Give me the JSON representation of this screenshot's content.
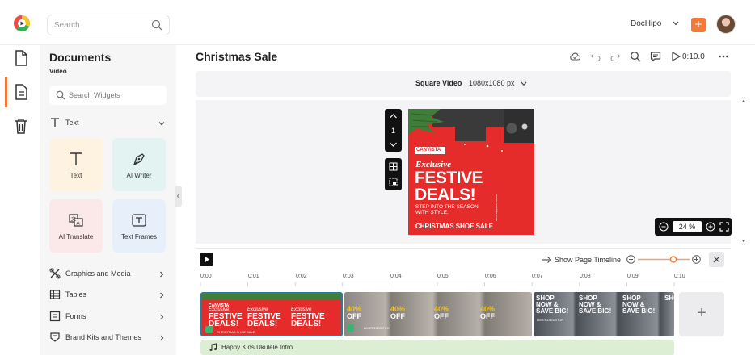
{
  "topbar": {
    "search_placeholder": "Search",
    "brand_label": "DocHipo",
    "add_label": "+",
    "colors": {
      "accent": "#f47a3b"
    }
  },
  "rail": {
    "icons": [
      "page-icon",
      "document-icon",
      "trash-icon"
    ]
  },
  "panel": {
    "title": "Documents",
    "subtitle": "Video",
    "widget_search_placeholder": "Search Widgets",
    "text_section": "Text",
    "tiles": [
      {
        "label": "Text",
        "icon": "text-t-icon",
        "bg": "#fdf3e0"
      },
      {
        "label": "AI Writer",
        "icon": "pen-nib-icon",
        "bg": "#e2f3f2"
      },
      {
        "label": "AI Translate",
        "icon": "translate-icon",
        "bg": "#fbe8e8"
      },
      {
        "label": "Text Frames",
        "icon": "text-frame-icon",
        "bg": "#e6effa"
      }
    ],
    "sections": [
      {
        "label": "Graphics and Media",
        "icon": "graphics-icon"
      },
      {
        "label": "Tables",
        "icon": "table-icon"
      },
      {
        "label": "Forms",
        "icon": "form-icon"
      },
      {
        "label": "Brand Kits and Themes",
        "icon": "brand-kit-icon"
      }
    ]
  },
  "editor": {
    "doc_title": "Christmas Sale",
    "timecode": "0:10.0",
    "size_label": "Square Video",
    "size_value": "1080x1080 px",
    "page_number": "1",
    "zoom_pct": "24 %"
  },
  "poster": {
    "brand": "CANVISTA",
    "line1": "Exclusive",
    "line2": "FESTIVE",
    "line3": "DEALS!",
    "tagline1": "STEP INTO THE SEASON",
    "tagline2": "WITH STYLE.",
    "footer": "CHRISTMAS SHOE SALE",
    "side_text": "www.canvista.com",
    "colors": {
      "red": "#e62b2b",
      "dark": "#3a3a3a"
    }
  },
  "timeline": {
    "show_label": "Show Page Timeline",
    "ruler": [
      "0:00",
      "0:01",
      "0:02",
      "0:03",
      "0:04",
      "0:05",
      "0:06",
      "0:07",
      "0:08",
      "0:09",
      "0:10"
    ],
    "scene1": {
      "line1": "Exclusive",
      "line2": "FESTIVE",
      "line3": "DEALS!",
      "brand": "CANVISTA",
      "footer": "CHRISTMAS SHOE SALE"
    },
    "scene2": {
      "big": "40%",
      "off": "OFF",
      "note": "LIMITED EDITION"
    },
    "scene3": {
      "line1": "SHOP",
      "line2": "NOW &",
      "line3": "SAVE BIG!",
      "note": "LIMITED EDITION"
    },
    "audio_label": "Happy Kids Ukulele Intro",
    "add_scene": "+"
  }
}
